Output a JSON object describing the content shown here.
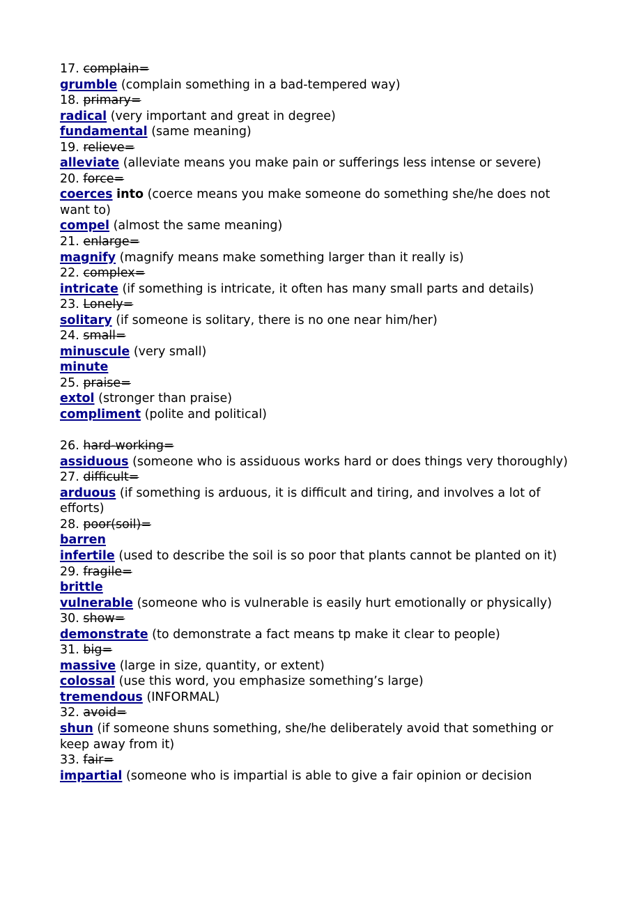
{
  "document": {
    "type": "vocabulary-synonym-list",
    "accent_color": "#00008b",
    "text_color": "#000000",
    "background_color": "#ffffff",
    "blocks": [
      {
        "entries": [
          {
            "number": "17.",
            "headword": "complain=",
            "synonyms": [
              {
                "term": "grumble",
                "gloss": "(complain something in a bad-tempered way)"
              }
            ]
          },
          {
            "number": "18.",
            "headword": "primary=",
            "synonyms": [
              {
                "term": "radical",
                "gloss": "(very important and great in degree)"
              },
              {
                "term": "fundamental",
                "gloss": "(same meaning)"
              }
            ]
          },
          {
            "number": "19.",
            "headword": "relieve=",
            "synonyms": [
              {
                "term": "alleviate",
                "gloss": "(alleviate means you make pain or sufferings less intense or severe)"
              }
            ]
          },
          {
            "number": "20.",
            "headword": "force=",
            "synonyms": [
              {
                "term": "coerces",
                "particle": "into",
                "gloss": "(coerce means you make someone do something she/he does not want to)"
              },
              {
                "term": "compel",
                "gloss": "(almost the same meaning)"
              }
            ]
          },
          {
            "number": "21.",
            "headword": "enlarge=",
            "synonyms": [
              {
                "term": "magnify",
                "gloss": "(magnify means make something larger than it really is)"
              }
            ]
          },
          {
            "number": "22.",
            "headword": "complex=",
            "synonyms": [
              {
                "term": "intricate",
                "gloss": "(if something is intricate, it often has many small parts and details)"
              }
            ]
          },
          {
            "number": "23.",
            "headword": "Lonely=",
            "synonyms": [
              {
                "term": "solitary",
                "gloss": "(if someone is solitary, there is no one near him/her)"
              }
            ]
          },
          {
            "number": "24.",
            "headword": "small=",
            "synonyms": [
              {
                "term": "minuscule",
                "gloss": "(very small)"
              },
              {
                "term": "minute ",
                "gloss": ""
              }
            ]
          },
          {
            "number": "25.",
            "headword": "praise=",
            "synonyms": [
              {
                "term": "extol",
                "gloss": "(stronger than praise)"
              },
              {
                "term": "compliment",
                "gloss": "(polite and political)"
              }
            ]
          }
        ]
      },
      {
        "entries": [
          {
            "number": "26.",
            "headword": "hard-working=",
            "synonyms": [
              {
                "term": "assiduous",
                "gloss": "(someone who is assiduous works hard or does things very thoroughly)"
              }
            ]
          },
          {
            "number": "27.",
            "headword": "difficult=",
            "synonyms": [
              {
                "term": "arduous",
                "gloss": "(if something is arduous, it is difficult and tiring, and involves a lot of efforts)"
              }
            ]
          },
          {
            "number": "28.",
            "headword": "poor(soil)=",
            "synonyms": [
              {
                "term": "barren",
                "gloss": ""
              },
              {
                "term": "infertile",
                "gloss": "(used to describe the soil is so poor that plants cannot be planted on it)"
              }
            ]
          },
          {
            "number": "29.",
            "headword": "fragile=",
            "synonyms": [
              {
                "term": "brittle",
                "gloss": ""
              },
              {
                "term": "vulnerable",
                "gloss": "(someone who is vulnerable is easily hurt emotionally or physically)"
              }
            ]
          },
          {
            "number": "30.",
            "headword": "show=",
            "synonyms": [
              {
                "term": "demonstrate",
                "gloss": "(to demonstrate a fact means tp make it clear to people)"
              }
            ]
          },
          {
            "number": "31.",
            "headword": "big=",
            "synonyms": [
              {
                "term": "massive",
                "gloss": "(large in size, quantity, or extent)"
              },
              {
                "term": "colossal",
                "gloss": "(use this word, you emphasize something’s large)"
              },
              {
                "term": "tremendous",
                "gloss": "(INFORMAL)"
              }
            ]
          },
          {
            "number": "32.",
            "headword": "avoid=",
            "synonyms": [
              {
                "term": "shun",
                "gloss": "(if someone shuns something, she/he deliberately avoid that something or keep away from it)"
              }
            ]
          },
          {
            "number": "33.",
            "headword": "fair=",
            "synonyms": [
              {
                "term": "impartial",
                "gloss": "(someone who is impartial is able to give a fair opinion or decision"
              }
            ]
          }
        ]
      }
    ]
  }
}
